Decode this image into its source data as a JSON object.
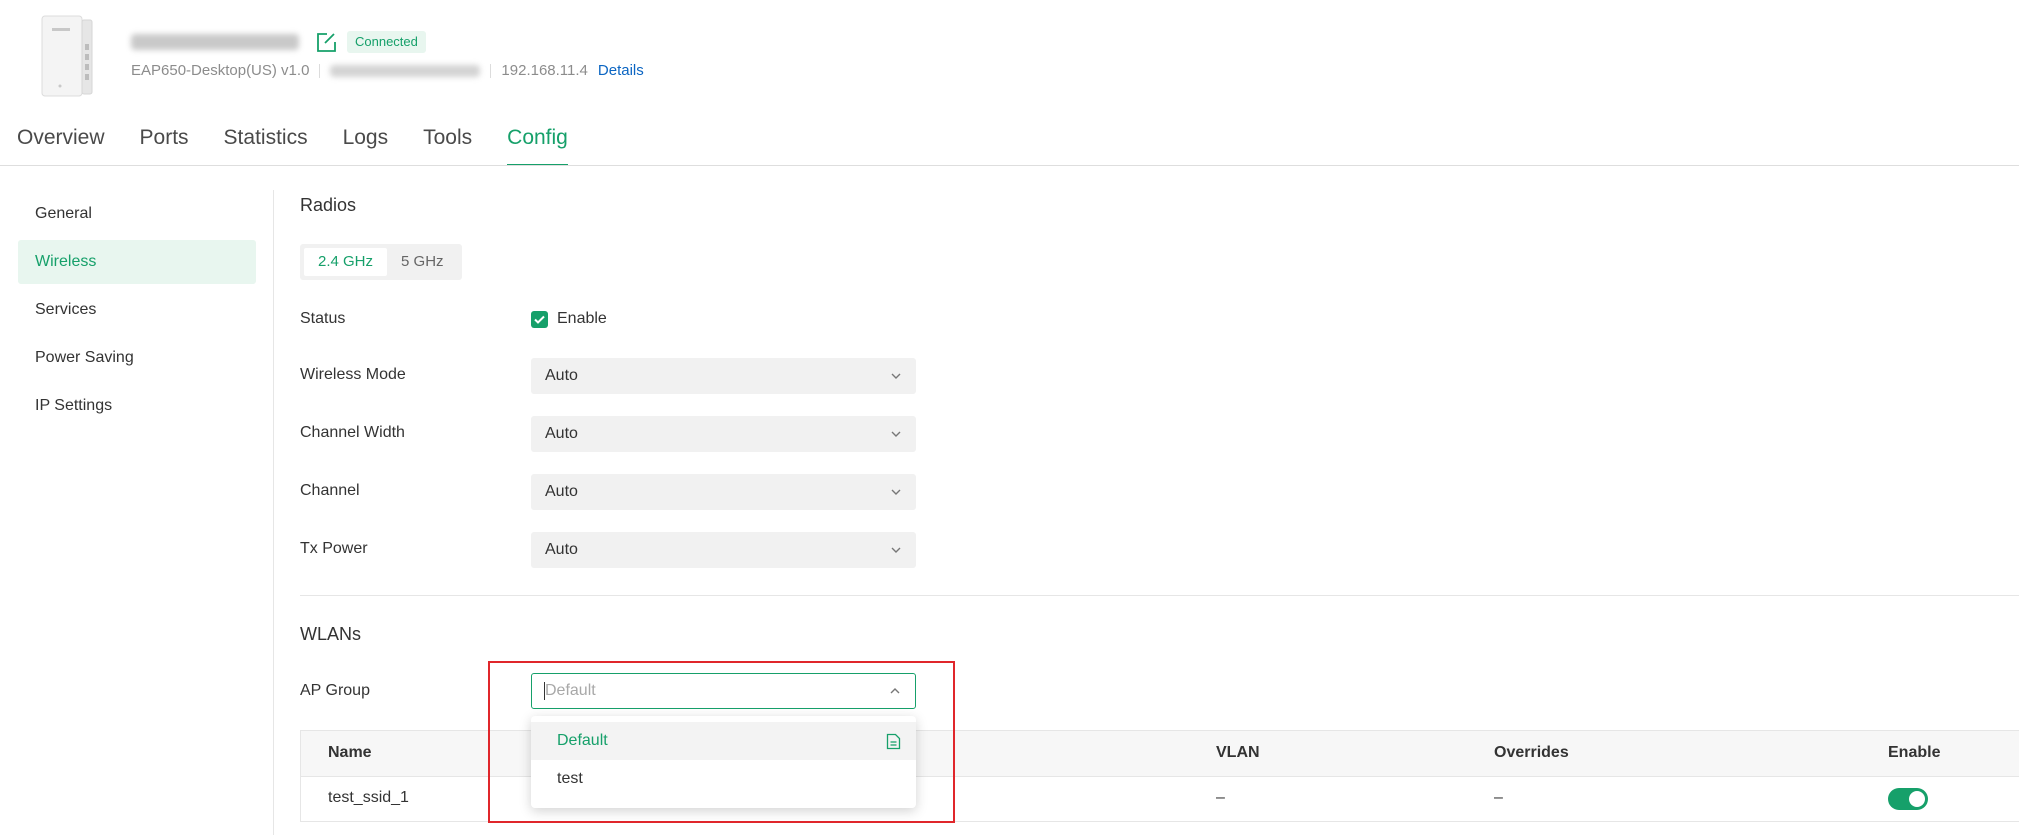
{
  "header": {
    "status_badge": "Connected",
    "model": "EAP650-Desktop(US) v1.0",
    "ip": "192.168.11.4",
    "details_label": "Details"
  },
  "tabs": [
    {
      "label": "Overview"
    },
    {
      "label": "Ports"
    },
    {
      "label": "Statistics"
    },
    {
      "label": "Logs"
    },
    {
      "label": "Tools"
    },
    {
      "label": "Config",
      "active": true
    }
  ],
  "sidebar": {
    "items": [
      {
        "label": "General"
      },
      {
        "label": "Wireless",
        "active": true
      },
      {
        "label": "Services"
      },
      {
        "label": "Power Saving"
      },
      {
        "label": "IP Settings"
      }
    ]
  },
  "radios": {
    "title": "Radios",
    "bands": [
      "2.4 GHz",
      "5 GHz"
    ],
    "active_band": "2.4 GHz",
    "status_label": "Status",
    "enable_label": "Enable",
    "enabled": true,
    "fields": [
      {
        "label": "Wireless Mode",
        "value": "Auto"
      },
      {
        "label": "Channel Width",
        "value": "Auto"
      },
      {
        "label": "Channel",
        "value": "Auto"
      },
      {
        "label": "Tx Power",
        "value": "Auto"
      }
    ]
  },
  "wlans": {
    "title": "WLANs",
    "ap_group_label": "AP Group",
    "ap_group_placeholder": "Default",
    "dropdown_options": [
      {
        "label": "Default",
        "selected": true
      },
      {
        "label": "test"
      }
    ],
    "table": {
      "columns": [
        "Name",
        "VLAN",
        "Overrides",
        "Enable"
      ],
      "rows": [
        {
          "name": "test_ssid_1",
          "vlan": "–",
          "overrides": "–",
          "enabled": true
        }
      ]
    }
  },
  "colors": {
    "accent": "#16a06a",
    "link": "#0b65c2",
    "highlight": "#e0262b"
  },
  "icons": {
    "edit": "edit-icon",
    "chevron": "chevron-down-icon",
    "document": "document-icon",
    "check": "check-icon"
  }
}
